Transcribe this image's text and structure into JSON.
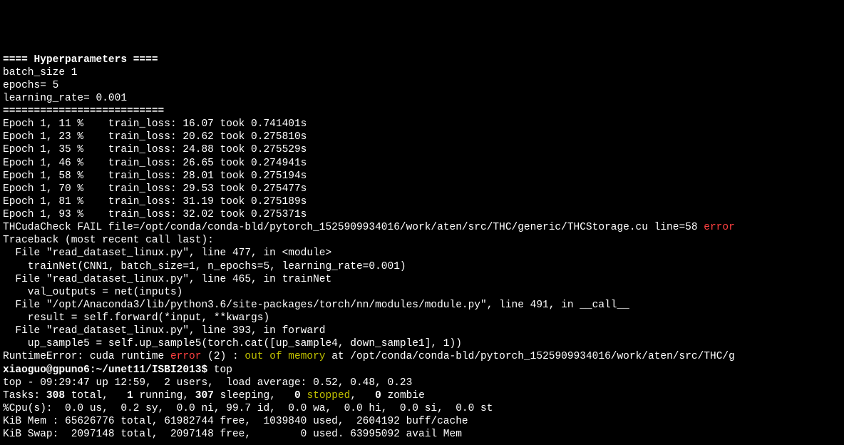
{
  "header": {
    "title": "==== Hyperparameters ====",
    "batch_size": "batch_size 1",
    "epochs": "epochs= 5",
    "learning_rate": "learning_rate= 0.001",
    "divider": "=========================="
  },
  "epochs": [
    "Epoch 1, 11 %    train_loss: 16.07 took 0.741401s",
    "Epoch 1, 23 %    train_loss: 20.62 took 0.275810s",
    "Epoch 1, 35 %    train_loss: 24.88 took 0.275529s",
    "Epoch 1, 46 %    train_loss: 26.65 took 0.274941s",
    "Epoch 1, 58 %    train_loss: 28.01 took 0.275194s",
    "Epoch 1, 70 %    train_loss: 29.53 took 0.275477s",
    "Epoch 1, 81 %    train_loss: 31.19 took 0.275189s",
    "Epoch 1, 93 %    train_loss: 32.02 took 0.275371s"
  ],
  "thcheck": {
    "prefix": "THCudaCheck FAIL file=/opt/conda/conda-bld/pytorch_1525909934016/work/aten/src/THC/generic/THCStorage.cu line=58 ",
    "error": "error"
  },
  "traceback": [
    "Traceback (most recent call last):",
    "  File \"read_dataset_linux.py\", line 477, in <module>",
    "    trainNet(CNN1, batch_size=1, n_epochs=5, learning_rate=0.001)",
    "  File \"read_dataset_linux.py\", line 465, in trainNet",
    "    val_outputs = net(inputs)",
    "  File \"/opt/Anaconda3/lib/python3.6/site-packages/torch/nn/modules/module.py\", line 491, in __call__",
    "    result = self.forward(*input, **kwargs)",
    "  File \"read_dataset_linux.py\", line 393, in forward",
    "    up_sample5 = self.up_sample5(torch.cat([up_sample4, down_sample1], 1))"
  ],
  "runtime_error": {
    "prefix": "RuntimeError: cuda runtime ",
    "error": "error",
    "mid": " (2) : ",
    "oom": "out of memory",
    "suffix": " at /opt/conda/conda-bld/pytorch_1525909934016/work/aten/src/THC/g"
  },
  "prompt": {
    "user_host": "xiaoguo@gpuno6",
    "cwd": ":~/unet11/ISBI2013$ ",
    "cmd": "top"
  },
  "top": {
    "line1": "top - 09:29:47 up 12:59,  2 users,  load average: 0.52, 0.48, 0.23",
    "tasks_prefix": "Tasks: ",
    "tasks_total": "308 ",
    "tasks_total_lbl": "total,   ",
    "tasks_running": "1 ",
    "tasks_running_lbl": "running, ",
    "tasks_sleeping": "307 ",
    "tasks_sleeping_lbl": "sleeping,   ",
    "tasks_stopped": "0 ",
    "tasks_stopped_lbl": "stopped",
    "tasks_comma": ",   ",
    "tasks_zombie": "0 ",
    "tasks_zombie_lbl": "zombie",
    "cpu": "%Cpu(s):  0.0 us,  0.2 sy,  0.0 ni, 99.7 id,  0.0 wa,  0.0 hi,  0.0 si,  0.0 st",
    "mem": "KiB Mem : 65626776 total, 61982744 free,  1039840 used,  2604192 buff/cache",
    "swap": "KiB Swap:  2097148 total,  2097148 free,        0 used. 63995092 avail Mem"
  }
}
